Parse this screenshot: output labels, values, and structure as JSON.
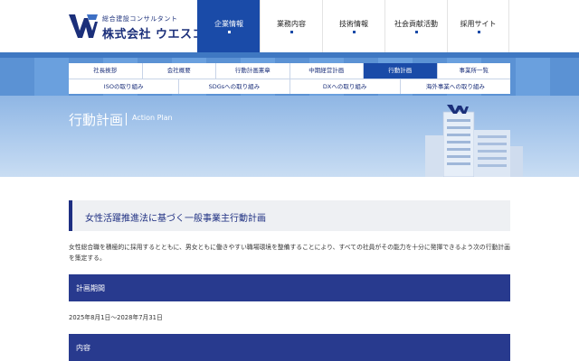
{
  "logo": {
    "sub": "総合建設コンサルタント",
    "main": "株式会社 ウエスコ"
  },
  "gnav": [
    {
      "label": "企業情報",
      "active": true
    },
    {
      "label": "業務内容",
      "active": false
    },
    {
      "label": "技術情報",
      "active": false
    },
    {
      "label": "社会貢献活動",
      "active": false
    },
    {
      "label": "採用サイト",
      "active": false
    }
  ],
  "subnav": {
    "row1": [
      "社長挨拶",
      "会社概要",
      "行動計画憲章",
      "中期経営計画",
      "行動計画",
      "事業所一覧"
    ],
    "row2": [
      "ISOの取り組み",
      "SDGsへの取り組み",
      "DXへの取り組み",
      "海外事業への取り組み"
    ],
    "active": "行動計画"
  },
  "hero": {
    "title": "行動計画",
    "subtitle": "Action Plan"
  },
  "content": {
    "heading": "女性活躍推進法に基づく一般事業主行動計画",
    "intro": "女性総合職を積極的に採用するとともに、男女ともに働きやすい職場環境を整備することにより、すべての社員がその能力を十分に発揮できるよう次の行動計画を策定する。",
    "section_period": "計画期間",
    "period": "2025年8月1日～2028年7月31日",
    "section_content": "内容"
  },
  "colors": {
    "primary": "#1a4ba8",
    "navy": "#283a8e",
    "band": "#5b92d4"
  }
}
